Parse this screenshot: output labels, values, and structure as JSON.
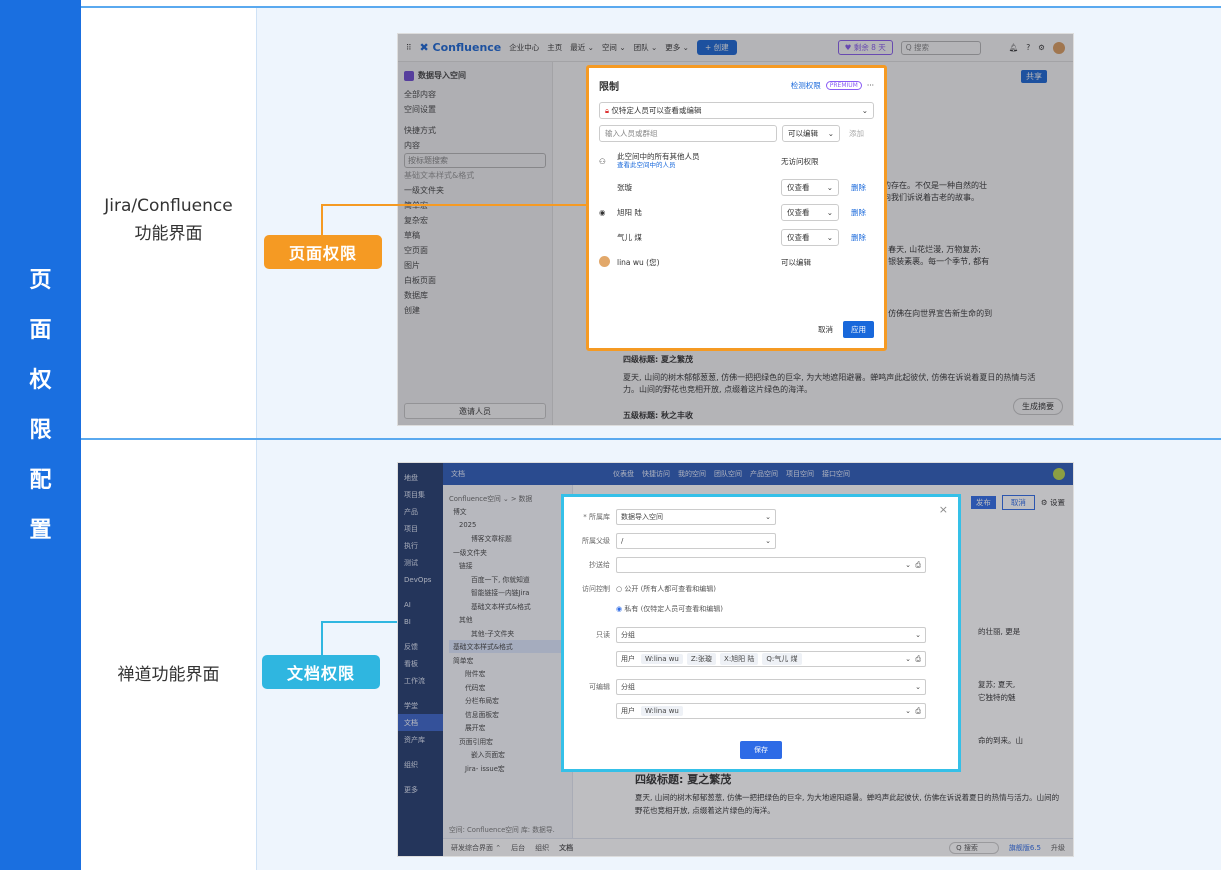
{
  "vertical_title": [
    "页",
    "面",
    "权",
    "限",
    "配",
    "置"
  ],
  "rows": [
    {
      "label_line1": "Jira/Confluence",
      "label_line2": "功能界面",
      "tag": "页面权限"
    },
    {
      "label_line1": "禅道功能界面",
      "label_line2": "",
      "tag": "文档权限"
    }
  ],
  "confluence": {
    "logo": "✖ Confluence",
    "topnav": [
      "企业中心",
      "主页",
      "最近 ⌄",
      "空间 ⌄",
      "团队 ⌄",
      "更多 ⌄"
    ],
    "create": "+ 创建",
    "trial": "♥ 剩余 8 天",
    "search_placeholder": "Q 搜索",
    "space_name": "数据导入空间",
    "sidebar": [
      "全部内容",
      "空间设置",
      "快捷方式",
      "内容",
      "按标题搜索",
      "基础文本样式&格式",
      "一级文件夹",
      "简单宏",
      "复杂宏",
      "草稿",
      "空页面",
      "图片",
      "白板页面",
      "数据库",
      "创建"
    ],
    "invite": "邀请人员",
    "share": "共享",
    "content_lines": [
      "的存在。不仅是一种自然的壮",
      "向我们诉说着古老的故事。",
      ", 春天, 山花烂漫, 万物复苏;",
      ", 银装素裹。每一个季节, 都有",
      ", 仿佛在向世界宣告新生命的到"
    ],
    "h4": "四级标题: 夏之繁茂",
    "para": "夏天, 山间的树木郁郁葱葱, 仿佛一把把绿色的巨伞, 为大地遮阳避暑。蝉鸣声此起彼伏, 仿佛在诉说着夏日的热情与活力。山间的野花也竞相开放, 点缀着这片绿色的海洋。",
    "h5": "五级标题: 秋之丰收",
    "summary": "生成摘要",
    "dialog": {
      "title": "限制",
      "check": "检测权限",
      "premium": "PREMIUM",
      "more": "···",
      "restriction": "仅特定人员可以查看或编辑",
      "input_placeholder": "输入人员或群组",
      "can_edit": "可以编辑",
      "add": "添加",
      "others_title": "此空间中的所有其他人员",
      "others_link": "查看此空间中的人员",
      "no_access": "无访问权限",
      "users": [
        {
          "name": "张璇",
          "perm": "仅查看",
          "action": "删除"
        },
        {
          "name": "旭阳 陆",
          "perm": "仅查看",
          "action": "删除"
        },
        {
          "name": "气儿 煤",
          "perm": "仅查看",
          "action": "删除"
        },
        {
          "name": "lina wu (您)",
          "perm": "可以编辑",
          "action": ""
        }
      ],
      "cancel": "取消",
      "apply": "应用"
    }
  },
  "zentao": {
    "nav": [
      "地盘",
      "项目集",
      "产品",
      "项目",
      "执行",
      "测试",
      "DevOps",
      "AI",
      "BI",
      "反馈",
      "看板",
      "工作流",
      "学堂",
      "文档",
      "资产库",
      "组织",
      "更多"
    ],
    "top_title": "文档",
    "top_links": [
      "仪表盘",
      "快捷访问",
      "我的空间",
      "团队空间",
      "产品空间",
      "项目空间",
      "接口空间"
    ],
    "breadcrumb": "Confluence空间 ⌄ > 数据",
    "tree": [
      "博文",
      "2025",
      "博客文章标题",
      "一级文件夹",
      "链接",
      "百度一下, 你就知道",
      "智能链接—内链Jira",
      "基础文本样式&格式",
      "其他",
      "其他-子文件夹",
      "基础文本样式&格式",
      "简单宏",
      "附件宏",
      "代码宏",
      "分栏布局宏",
      "信息面板宏",
      "展开宏",
      "页面引用宏",
      "嵌入页面宏",
      "Jira- issue宏"
    ],
    "tree_footer": "空间: Confluence空间 库: 数据导.",
    "h4": "四级标题: 夏之繁茂",
    "para": "夏天, 山间的树木郁郁葱葱, 仿佛一把把绿色的巨伞, 为大地遮阳避暑。蝉鸣声此起彼伏, 仿佛在诉说着夏日的热情与活力。山间的野花也竞相开放, 点缀着这片绿色的海洋。",
    "right_bits": [
      "的壮丽, 更是",
      "复苏; 夏天,",
      "它独特的魅",
      "命的到来。山"
    ],
    "top_buttons": [
      "发布",
      "取消",
      "⚙ 设置"
    ],
    "bottom": [
      "研发综合界面 ⌃",
      "后台",
      "组织",
      "文档"
    ],
    "bottom_search": "Q 搜索",
    "version": "旗舰版6.5",
    "upgrade": "升级",
    "dialog": {
      "fields": [
        {
          "label": "* 所属库",
          "value": "数据导入空间"
        },
        {
          "label": "所属父级",
          "value": "/"
        },
        {
          "label": "抄送给",
          "value": ""
        }
      ],
      "access_label": "访问控制",
      "opt_public": "公开 (所有人都可查看和编辑)",
      "opt_private": "私有 (仅特定人员可查看和编辑)",
      "readonly_label": "只读",
      "group_label": "分组",
      "user_label": "用户",
      "readonly_users": [
        "W:lina wu",
        "Z:张璇",
        "X:旭阳 陆",
        "Q:气儿 煤"
      ],
      "editable_label": "可编辑",
      "editable_users": [
        "W:lina wu"
      ],
      "save": "保存",
      "close": "×"
    }
  }
}
